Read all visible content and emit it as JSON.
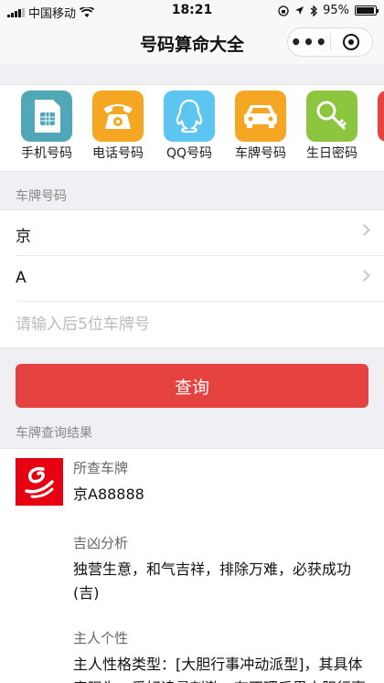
{
  "status_bar": {
    "carrier": "中国移动",
    "time": "18:21",
    "battery_text": "95%",
    "battery_level": 0.95
  },
  "nav": {
    "title": "号码算命大全",
    "more_label": "•••"
  },
  "icons": [
    {
      "label": "手机号码",
      "icon": "sim-card-icon",
      "color": "#4fa7b7"
    },
    {
      "label": "电话号码",
      "icon": "telephone-icon",
      "color": "#f5a623"
    },
    {
      "label": "QQ号码",
      "icon": "qq-penguin-icon",
      "color": "#5cc6f0"
    },
    {
      "label": "车牌号码",
      "icon": "car-icon",
      "color": "#f5a623"
    },
    {
      "label": "生日密码",
      "icon": "key-icon",
      "color": "#8cc63f"
    }
  ],
  "form": {
    "section_label": "车牌号码",
    "province": "京",
    "letter": "A",
    "plate_placeholder": "请输入后5位车牌号",
    "submit_label": "查询"
  },
  "result": {
    "section_label": "车牌查询结果",
    "plate_title": "所查车牌",
    "plate_value": "京A88888",
    "fortune_title": "吉凶分析",
    "fortune_text": "独营生意，和气吉祥，排除万难，必获成功(吉)",
    "personality_title": "主人个性",
    "personality_text": "主人性格类型：[大胆行事冲动派型]，其具体表现为：爱好追寻刺激，有不理后果大胆行事"
  },
  "colors": {
    "primary_button": "#e64340",
    "logo_red": "#e60012"
  }
}
